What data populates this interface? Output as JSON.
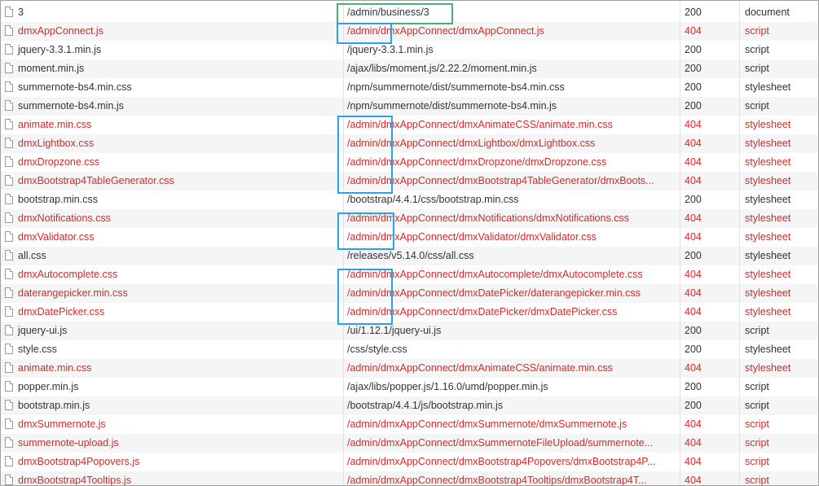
{
  "network_requests": [
    {
      "name": "3",
      "path": "/admin/business/3",
      "status": "200",
      "type": "document",
      "error": false
    },
    {
      "name": "dmxAppConnect.js",
      "path": "/admin/dmxAppConnect/dmxAppConnect.js",
      "status": "404",
      "type": "script",
      "error": true
    },
    {
      "name": "jquery-3.3.1.min.js",
      "path": "/jquery-3.3.1.min.js",
      "status": "200",
      "type": "script",
      "error": false
    },
    {
      "name": "moment.min.js",
      "path": "/ajax/libs/moment.js/2.22.2/moment.min.js",
      "status": "200",
      "type": "script",
      "error": false
    },
    {
      "name": "summernote-bs4.min.css",
      "path": "/npm/summernote/dist/summernote-bs4.min.css",
      "status": "200",
      "type": "stylesheet",
      "error": false
    },
    {
      "name": "summernote-bs4.min.js",
      "path": "/npm/summernote/dist/summernote-bs4.min.js",
      "status": "200",
      "type": "script",
      "error": false
    },
    {
      "name": "animate.min.css",
      "path": "/admin/dmxAppConnect/dmxAnimateCSS/animate.min.css",
      "status": "404",
      "type": "stylesheet",
      "error": true
    },
    {
      "name": "dmxLightbox.css",
      "path": "/admin/dmxAppConnect/dmxLightbox/dmxLightbox.css",
      "status": "404",
      "type": "stylesheet",
      "error": true
    },
    {
      "name": "dmxDropzone.css",
      "path": "/admin/dmxAppConnect/dmxDropzone/dmxDropzone.css",
      "status": "404",
      "type": "stylesheet",
      "error": true
    },
    {
      "name": "dmxBootstrap4TableGenerator.css",
      "path": "/admin/dmxAppConnect/dmxBootstrap4TableGenerator/dmxBoots...",
      "status": "404",
      "type": "stylesheet",
      "error": true
    },
    {
      "name": "bootstrap.min.css",
      "path": "/bootstrap/4.4.1/css/bootstrap.min.css",
      "status": "200",
      "type": "stylesheet",
      "error": false
    },
    {
      "name": "dmxNotifications.css",
      "path": "/admin/dmxAppConnect/dmxNotifications/dmxNotifications.css",
      "status": "404",
      "type": "stylesheet",
      "error": true
    },
    {
      "name": "dmxValidator.css",
      "path": "/admin/dmxAppConnect/dmxValidator/dmxValidator.css",
      "status": "404",
      "type": "stylesheet",
      "error": true
    },
    {
      "name": "all.css",
      "path": "/releases/v5.14.0/css/all.css",
      "status": "200",
      "type": "stylesheet",
      "error": false
    },
    {
      "name": "dmxAutocomplete.css",
      "path": "/admin/dmxAppConnect/dmxAutocomplete/dmxAutocomplete.css",
      "status": "404",
      "type": "stylesheet",
      "error": true
    },
    {
      "name": "daterangepicker.min.css",
      "path": "/admin/dmxAppConnect/dmxDatePicker/daterangepicker.min.css",
      "status": "404",
      "type": "stylesheet",
      "error": true
    },
    {
      "name": "dmxDatePicker.css",
      "path": "/admin/dmxAppConnect/dmxDatePicker/dmxDatePicker.css",
      "status": "404",
      "type": "stylesheet",
      "error": true
    },
    {
      "name": "jquery-ui.js",
      "path": "/ui/1.12.1/jquery-ui.js",
      "status": "200",
      "type": "script",
      "error": false
    },
    {
      "name": "style.css",
      "path": "/css/style.css",
      "status": "200",
      "type": "stylesheet",
      "error": false
    },
    {
      "name": "animate.min.css",
      "path": "/admin/dmxAppConnect/dmxAnimateCSS/animate.min.css",
      "status": "404",
      "type": "stylesheet",
      "error": true
    },
    {
      "name": "popper.min.js",
      "path": "/ajax/libs/popper.js/1.16.0/umd/popper.min.js",
      "status": "200",
      "type": "script",
      "error": false
    },
    {
      "name": "bootstrap.min.js",
      "path": "/bootstrap/4.4.1/js/bootstrap.min.js",
      "status": "200",
      "type": "script",
      "error": false
    },
    {
      "name": "dmxSummernote.js",
      "path": "/admin/dmxAppConnect/dmxSummernote/dmxSummernote.js",
      "status": "404",
      "type": "script",
      "error": true
    },
    {
      "name": "summernote-upload.js",
      "path": "/admin/dmxAppConnect/dmxSummernoteFileUpload/summernote...",
      "status": "404",
      "type": "script",
      "error": true
    },
    {
      "name": "dmxBootstrap4Popovers.js",
      "path": "/admin/dmxAppConnect/dmxBootstrap4Popovers/dmxBootstrap4P...",
      "status": "404",
      "type": "script",
      "error": true
    },
    {
      "name": "dmxBootstrap4Tooltips.js",
      "path": "/admin/dmxAppConnect/dmxBootstrap4Tooltips/dmxBootstrap4T...",
      "status": "404",
      "type": "script",
      "error": true
    }
  ],
  "colors": {
    "error_text": "#d42a2a",
    "normal_text": "#333333",
    "alt_row_bg": "#f5f5f5",
    "highlight_green": "#4caf72",
    "highlight_blue": "#2aa3e6"
  },
  "icons": {
    "row_icon": "file-icon"
  }
}
